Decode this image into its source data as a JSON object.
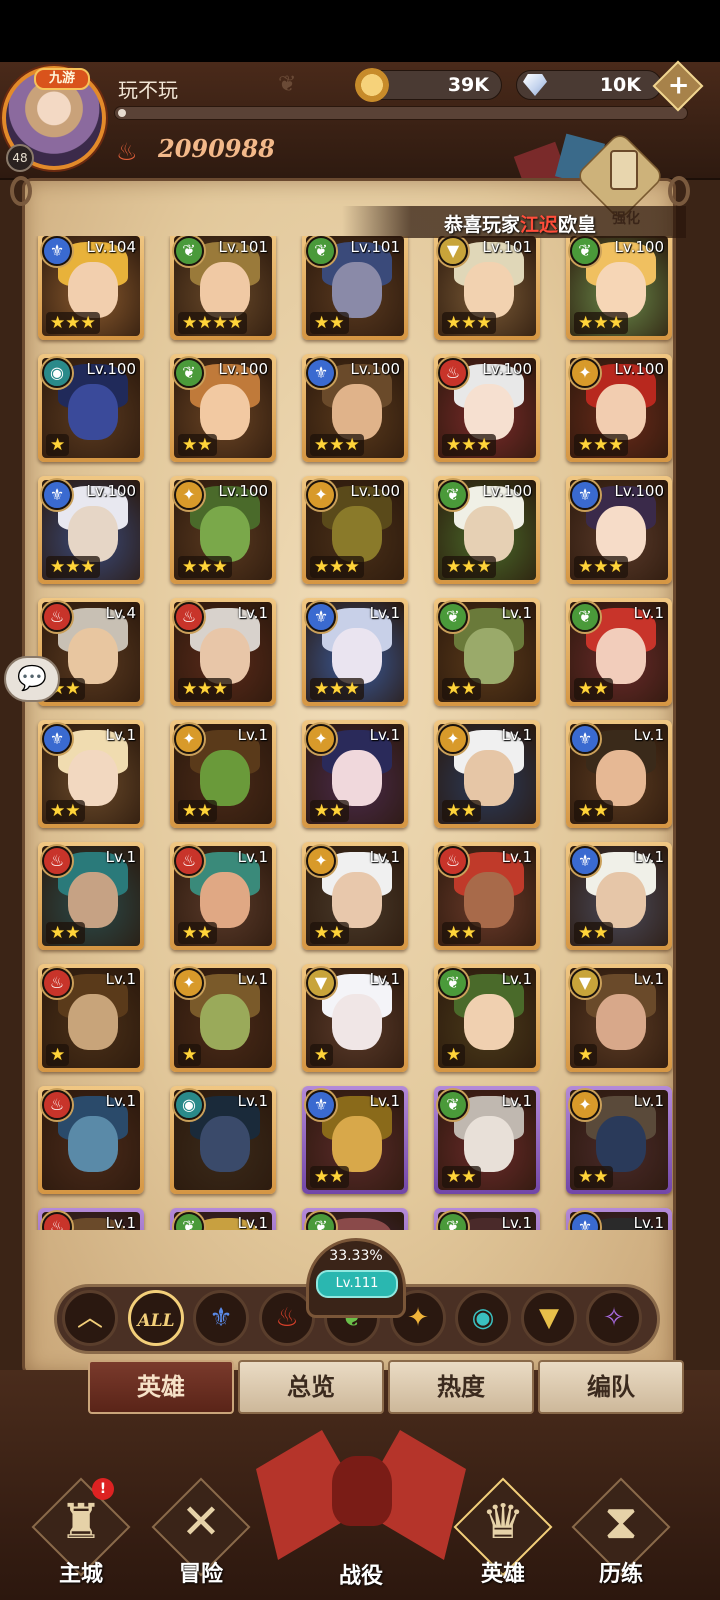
{
  "header": {
    "avatar_tag": "九游",
    "player_level": "48",
    "player_name": "玩不玩",
    "gold": "39K",
    "gems": "10K",
    "plus_label": "+",
    "combat_power": "2090988",
    "strengthen_label": "强化"
  },
  "notice": {
    "prefix": "恭喜玩家",
    "highlight": "江迟",
    "suffix": "欧皇"
  },
  "heroes": [
    {
      "level": "Lv.104",
      "faction": "water",
      "stars": 3,
      "skin": "#f2cfae",
      "hair": "#e8b23a",
      "bg": "#8a5a2e",
      "rarity": "gold"
    },
    {
      "level": "Lv.101",
      "faction": "forest",
      "stars": 4,
      "skin": "#f0c9a4",
      "hair": "#9a7a3a",
      "bg": "#6a4a2a",
      "rarity": "gold"
    },
    {
      "level": "Lv.101",
      "faction": "forest",
      "stars": 2,
      "skin": "#8a8aa8",
      "hair": "#3a4a7a",
      "bg": "#5a3a20",
      "rarity": "gold"
    },
    {
      "level": "Lv.101",
      "faction": "light",
      "stars": 3,
      "skin": "#f2d2b0",
      "hair": "#e0d7b8",
      "bg": "#7a5a36",
      "rarity": "gold"
    },
    {
      "level": "Lv.100",
      "faction": "forest",
      "stars": 3,
      "skin": "#f6d6b6",
      "hair": "#f0c060",
      "bg": "#6a8a4a",
      "rarity": "gold"
    },
    {
      "level": "Lv.100",
      "faction": "dark",
      "stars": 1,
      "skin": "#3a4a9a",
      "hair": "#202a5a",
      "bg": "#5a3a20",
      "rarity": "gold"
    },
    {
      "level": "Lv.100",
      "faction": "forest",
      "stars": 2,
      "skin": "#f2c9a2",
      "hair": "#c07a3a",
      "bg": "#6a4424",
      "rarity": "gold"
    },
    {
      "level": "Lv.100",
      "faction": "water",
      "stars": 3,
      "skin": "#e0b38a",
      "hair": "#6a4a2a",
      "bg": "#5a3a1c",
      "rarity": "gold"
    },
    {
      "level": "Lv.100",
      "faction": "fire",
      "stars": 3,
      "skin": "#f6e0d0",
      "hair": "#e8e8e8",
      "bg": "#7a2a2a",
      "rarity": "gold"
    },
    {
      "level": "Lv.100",
      "faction": "star",
      "stars": 3,
      "skin": "#f2cdb0",
      "hair": "#b8281e",
      "bg": "#6a2a1a",
      "rarity": "gold"
    },
    {
      "level": "Lv.100",
      "faction": "water",
      "stars": 3,
      "skin": "#e6d6c6",
      "hair": "#e8e8f0",
      "bg": "#3a4a7a",
      "rarity": "gold"
    },
    {
      "level": "Lv.100",
      "faction": "star",
      "stars": 3,
      "skin": "#7aa84a",
      "hair": "#4a6a2a",
      "bg": "#5a3a20",
      "rarity": "gold"
    },
    {
      "level": "Lv.100",
      "faction": "star",
      "stars": 3,
      "skin": "#8a7a2a",
      "hair": "#5a4a1a",
      "bg": "#4a3018",
      "rarity": "gold"
    },
    {
      "level": "Lv.100",
      "faction": "forest",
      "stars": 3,
      "skin": "#e6d0b4",
      "hair": "#f0f0e6",
      "bg": "#4a6a2a",
      "rarity": "gold"
    },
    {
      "level": "Lv.100",
      "faction": "water",
      "stars": 3,
      "skin": "#f6dcc8",
      "hair": "#3a2a4a",
      "bg": "#5a3a2a",
      "rarity": "gold"
    },
    {
      "level": "Lv.4",
      "faction": "fire",
      "stars": 2,
      "skin": "#e8c6a0",
      "hair": "#c8c0b4",
      "bg": "#5a3a20",
      "rarity": "gold"
    },
    {
      "level": "Lv.1",
      "faction": "fire",
      "stars": 3,
      "skin": "#e8c6a8",
      "hair": "#d8d2cc",
      "bg": "#5a2a1a",
      "rarity": "gold"
    },
    {
      "level": "Lv.1",
      "faction": "water",
      "stars": 3,
      "skin": "#eae4f0",
      "hair": "#c8d0e8",
      "bg": "#3a5a9a",
      "rarity": "gold"
    },
    {
      "level": "Lv.1",
      "faction": "forest",
      "stars": 2,
      "skin": "#9aaa6a",
      "hair": "#6a7a3a",
      "bg": "#5a3a1a",
      "rarity": "gold"
    },
    {
      "level": "Lv.1",
      "faction": "forest",
      "stars": 2,
      "skin": "#f2cdbb",
      "hair": "#c8342a",
      "bg": "#6a2a2a",
      "rarity": "gold"
    },
    {
      "level": "Lv.1",
      "faction": "water",
      "stars": 2,
      "skin": "#f2d8c0",
      "hair": "#f0dcb0",
      "bg": "#6a4a2a",
      "rarity": "gold"
    },
    {
      "level": "Lv.1",
      "faction": "star",
      "stars": 2,
      "skin": "#6a9a3a",
      "hair": "#5a3a1a",
      "bg": "#4a2a18",
      "rarity": "gold"
    },
    {
      "level": "Lv.1",
      "faction": "star",
      "stars": 2,
      "skin": "#f0d8dc",
      "hair": "#2a2a5a",
      "bg": "#4a2a4a",
      "rarity": "gold"
    },
    {
      "level": "Lv.1",
      "faction": "star",
      "stars": 2,
      "skin": "#e6c6a6",
      "hair": "#f0f0f0",
      "bg": "#2a3a5a",
      "rarity": "gold"
    },
    {
      "level": "Lv.1",
      "faction": "water",
      "stars": 2,
      "skin": "#e6b894",
      "hair": "#3a2a1a",
      "bg": "#5a3a20",
      "rarity": "gold"
    },
    {
      "level": "Lv.1",
      "faction": "fire",
      "stars": 2,
      "skin": "#c6a284",
      "hair": "#2a7a7a",
      "bg": "#2a4a4a",
      "rarity": "gold"
    },
    {
      "level": "Lv.1",
      "faction": "fire",
      "stars": 2,
      "skin": "#e0a884",
      "hair": "#3a8a7a",
      "bg": "#5a3a2a",
      "rarity": "gold"
    },
    {
      "level": "Lv.1",
      "faction": "star",
      "stars": 2,
      "skin": "#e8c8ac",
      "hair": "#f0f0f0",
      "bg": "#4a3a2a",
      "rarity": "gold"
    },
    {
      "level": "Lv.1",
      "faction": "fire",
      "stars": 2,
      "skin": "#a86a4a",
      "hair": "#c03a2a",
      "bg": "#6a3a2a",
      "rarity": "gold"
    },
    {
      "level": "Lv.1",
      "faction": "water",
      "stars": 2,
      "skin": "#e6c6a8",
      "hair": "#f0f0e8",
      "bg": "#4a4a5a",
      "rarity": "gold"
    },
    {
      "level": "Lv.1",
      "faction": "fire",
      "stars": 1,
      "skin": "#c8a47a",
      "hair": "#5a3a1a",
      "bg": "#4a3018",
      "rarity": "gold"
    },
    {
      "level": "Lv.1",
      "faction": "star",
      "stars": 1,
      "skin": "#9aaa5a",
      "hair": "#7a5a2a",
      "bg": "#4a2a18",
      "rarity": "gold"
    },
    {
      "level": "Lv.1",
      "faction": "light",
      "stars": 1,
      "skin": "#f0e6e6",
      "hair": "#f4f4f8",
      "bg": "#5a3a2a",
      "rarity": "gold"
    },
    {
      "level": "Lv.1",
      "faction": "forest",
      "stars": 1,
      "skin": "#f0d0b0",
      "hair": "#4a6a2a",
      "bg": "#4a3a1a",
      "rarity": "gold"
    },
    {
      "level": "Lv.1",
      "faction": "light",
      "stars": 1,
      "skin": "#d8a88a",
      "hair": "#6a4a2a",
      "bg": "#5a3a24",
      "rarity": "gold"
    },
    {
      "level": "Lv.1",
      "faction": "fire",
      "stars": 0,
      "skin": "#5a8aa8",
      "hair": "#2a4a6a",
      "bg": "#4a2a1a",
      "rarity": "gold"
    },
    {
      "level": "Lv.1",
      "faction": "dark",
      "stars": 0,
      "skin": "#3a4a6a",
      "hair": "#1a2a3a",
      "bg": "#3a2a1a",
      "rarity": "gold"
    },
    {
      "level": "Lv.1",
      "faction": "water",
      "stars": 2,
      "skin": "#d8a84a",
      "hair": "#8a6a1a",
      "bg": "#5a2a2a",
      "rarity": "purple"
    },
    {
      "level": "Lv.1",
      "faction": "forest",
      "stars": 2,
      "skin": "#e8e0d8",
      "hair": "#c0b8b0",
      "bg": "#6a2a2a",
      "rarity": "purple"
    },
    {
      "level": "Lv.1",
      "faction": "star",
      "stars": 2,
      "skin": "#2a3a5a",
      "hair": "#5a4a3a",
      "bg": "#4a2a2a",
      "rarity": "purple"
    },
    {
      "level": "Lv.1",
      "faction": "fire",
      "stars": 0,
      "skin": "#e8c8a8",
      "hair": "#6a4a2a",
      "bg": "#4a2a4a",
      "rarity": "purple"
    },
    {
      "level": "Lv.1",
      "faction": "forest",
      "stars": 0,
      "skin": "#e8c8a8",
      "hair": "#c8a040",
      "bg": "#4a2a4a",
      "rarity": "purple"
    },
    {
      "level": "",
      "faction": "forest",
      "stars": 0,
      "skin": "#e8c8a8",
      "hair": "#8a4a4a",
      "bg": "#4a2a4a",
      "rarity": "purple"
    },
    {
      "level": "Lv.1",
      "faction": "forest",
      "stars": 0,
      "skin": "#e8c8a8",
      "hair": "#4a2a2a",
      "bg": "#4a2a4a",
      "rarity": "purple"
    },
    {
      "level": "Lv.1",
      "faction": "water",
      "stars": 0,
      "skin": "#e8c8a8",
      "hair": "#2a2a2a",
      "bg": "#4a2a4a",
      "rarity": "purple"
    }
  ],
  "faction_icons": {
    "water": {
      "glyph": "⚜",
      "color": "#3a6ad0"
    },
    "forest": {
      "glyph": "❦",
      "color": "#4a9a3a"
    },
    "fire": {
      "glyph": "♨",
      "color": "#c8342a"
    },
    "star": {
      "glyph": "✦",
      "color": "#d89a2a"
    },
    "dark": {
      "glyph": "◉",
      "color": "#2a8a8a"
    },
    "light": {
      "glyph": "▼",
      "color": "#c8a43a"
    },
    "void": {
      "glyph": "✧",
      "color": "#8a4ac8"
    }
  },
  "experience": {
    "percent": "33.33%",
    "level": "Lv.111"
  },
  "filters": [
    {
      "name": "collapse",
      "glyph": "︿",
      "color": "#f3cf7a"
    },
    {
      "name": "all",
      "label": "ALL"
    },
    {
      "name": "water",
      "glyph": "⚜",
      "color": "#5a8ae8"
    },
    {
      "name": "fire",
      "glyph": "♨",
      "color": "#d8402a"
    },
    {
      "name": "forest",
      "glyph": "❦",
      "color": "#6ac04a"
    },
    {
      "name": "star",
      "glyph": "✦",
      "color": "#f0b43a"
    },
    {
      "name": "dark",
      "glyph": "◉",
      "color": "#3ac0c0"
    },
    {
      "name": "light",
      "glyph": "▼",
      "color": "#e8c04a"
    },
    {
      "name": "void",
      "glyph": "✧",
      "color": "#a86ae0"
    }
  ],
  "tabs": [
    "英雄",
    "总览",
    "热度",
    "编队"
  ],
  "nav": {
    "city": "主城",
    "city_alert": "!",
    "adventure": "冒险",
    "campaign": "战役",
    "heroes": "英雄",
    "trials": "历练"
  },
  "chat_glyph": "💬"
}
